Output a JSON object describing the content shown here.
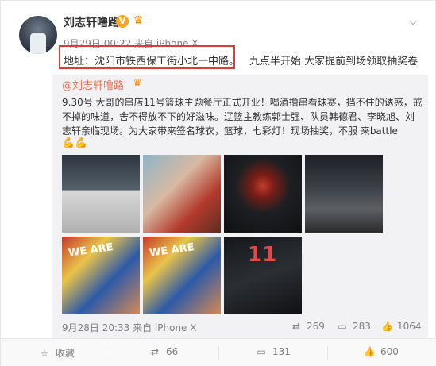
{
  "post": {
    "author": "刘志轩噜路",
    "verified_badge": "V",
    "meta": "9月29日 00:22 来自 iPhone X",
    "address": "地址：沈阳市铁西保工街小北一中路。",
    "announcement": "九点半开始 大家提前到场领取抽奖卷"
  },
  "repost": {
    "author": "@刘志轩噜路",
    "text_lines": [
      "9.30号 大哥的串店11号篮球主题餐厅正式开业！喝酒撸串看球赛，挡不住的诱惑，戒",
      "不掉的味道，舍不得放不下的好滋味。辽篮主教练郭士强、队员韩德君、李晓旭、刘",
      "志轩亲临现场。为大家带来签名球衣，篮球，七彩灯！现场抽奖，不服 来battle"
    ],
    "emoji": "💪💪",
    "images": {
      "wall_text_1": "WE ARE",
      "wall_text_2": "WE ARE",
      "jersey_number": "11"
    },
    "meta": "9月28日 20:33 来自 iPhone X",
    "repost_count": "269",
    "comment_count": "283",
    "like_count": "1064"
  },
  "actions": {
    "favorite": "收藏",
    "repost": "66",
    "comment": "131",
    "like": "600"
  },
  "icons": {
    "chevron": "chevron-down-icon",
    "favorite": "star-icon",
    "repost": "repost-icon",
    "comment": "comment-icon",
    "like": "thumbs-up-icon"
  },
  "colors": {
    "link": "#eb7350",
    "highlight": "#e53935",
    "badge": "#f5a623"
  }
}
